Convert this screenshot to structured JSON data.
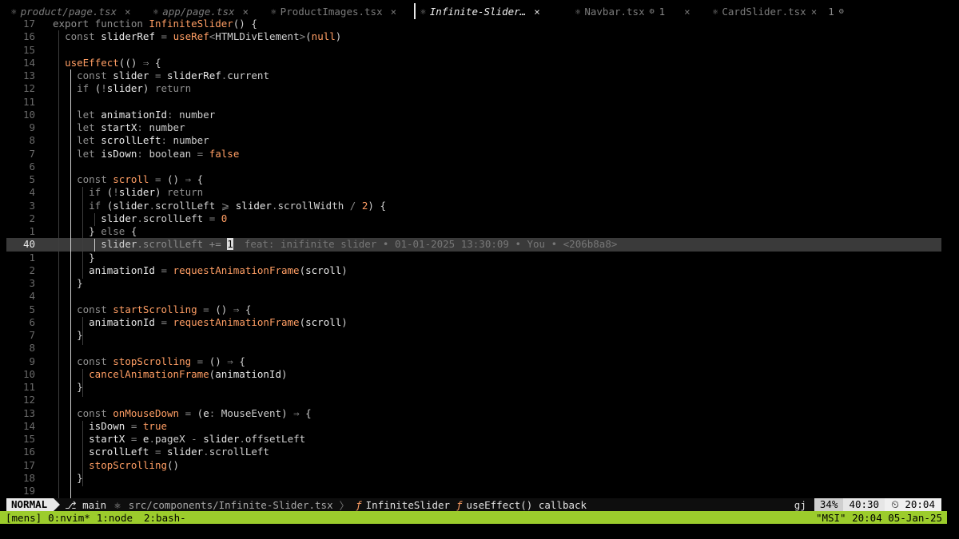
{
  "tabs": [
    {
      "icon": "react-icon",
      "name": "product/page.tsx",
      "italic": true,
      "close": "×"
    },
    {
      "icon": "react-icon",
      "name": "app/page.tsx",
      "italic": true,
      "close": "×"
    },
    {
      "icon": "react-icon",
      "name": "ProductImages.tsx",
      "italic": false,
      "close": "×"
    },
    {
      "icon": "react-icon",
      "name": "Infinite-Slider…",
      "italic": true,
      "close": "×",
      "active": true
    },
    {
      "icon": "react-icon",
      "name": "Navbar.tsx",
      "italic": false,
      "diag": "1",
      "close": "×"
    },
    {
      "icon": "react-icon",
      "name": "CardSlider.tsx",
      "italic": false,
      "close": "×",
      "diag": "1"
    }
  ],
  "blame": "feat: inifinite slider • 01-01-2025 13:30:09 • You • <206b8a8>",
  "statusline": {
    "mode": "NORMAL",
    "branch": "main",
    "path": "src/components/Infinite-Slider.tsx",
    "crumb1": "InfiniteSlider",
    "crumb2": "useEffect() callback",
    "gj": "gj",
    "percent": "34%",
    "position": "40:30",
    "clock": "20:04"
  },
  "tmux": {
    "session": "[mens]",
    "w0": "0:nvim*",
    "w1": "1:node",
    "w2": "2:bash-",
    "right": "\"MSI\" 20:04 05-Jan-25"
  },
  "colors": {
    "accent": "#9ccc2c",
    "keyword": "#8f8f8f",
    "function": "#ff9e64"
  }
}
